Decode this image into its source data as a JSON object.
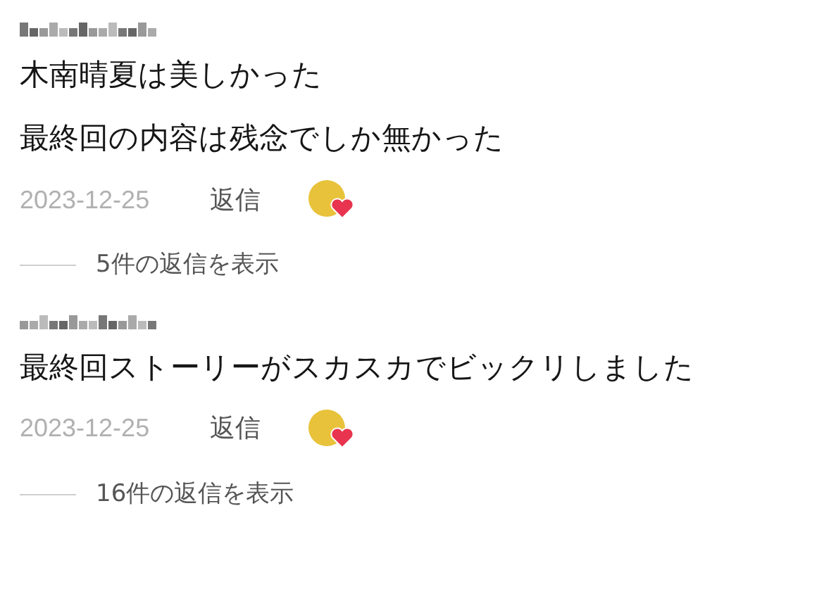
{
  "comments": [
    {
      "lines": [
        "木南晴夏は美しかった",
        "最終回の内容は残念でしか無かった"
      ],
      "date": "2023-12-25",
      "reply_label": "返信",
      "view_replies": "5件の返信を表示"
    },
    {
      "lines": [
        "最終回ストーリーがスカスカでビックリしました"
      ],
      "date": "2023-12-25",
      "reply_label": "返信",
      "view_replies": "16件の返信を表示"
    }
  ]
}
